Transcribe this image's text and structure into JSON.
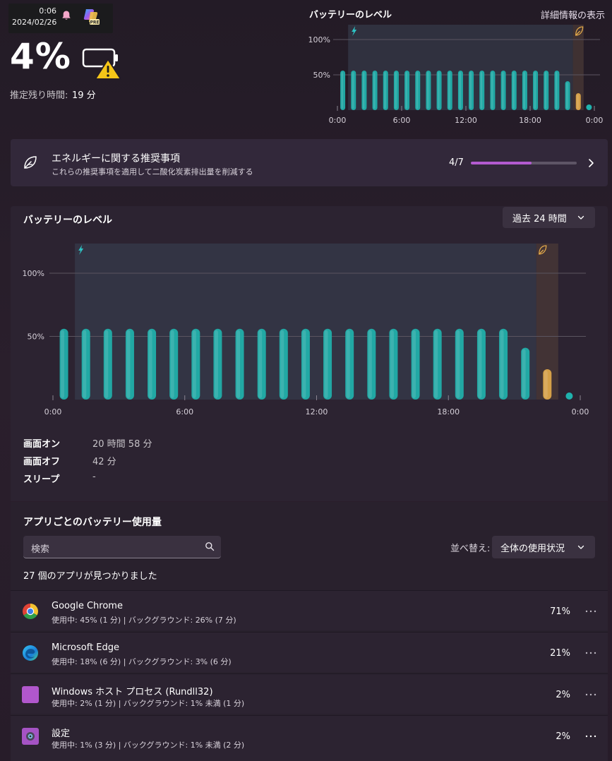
{
  "overlay": {
    "time": "0:06",
    "date": "2024/02/26",
    "bell_icon": "bell-icon",
    "copilot_icon": "copilot-pre-icon",
    "copilot_badge": "PRE"
  },
  "battery": {
    "percent": "4%",
    "icon": "battery-warning-icon",
    "remaining_label": "推定残り時間:",
    "remaining_value": "19 分"
  },
  "mini_chart": {
    "title": "バッテリーのレベル",
    "details_link": "詳細情報の表示"
  },
  "recommendation": {
    "icon": "leaf-icon",
    "title": "エネルギーに関する推奨事項",
    "subtitle": "これらの推奨事項を適用して二酸化炭素排出量を削減する",
    "count": "4/7",
    "progress": 0.571,
    "accent": "#b35bd0"
  },
  "battery_level": {
    "title": "バッテリーのレベル",
    "range_label": "過去 24 時間",
    "stats": [
      {
        "label": "画面オン",
        "value": "20 時間 58 分"
      },
      {
        "label": "画面オフ",
        "value": "42 分"
      },
      {
        "label": "スリープ",
        "value": "-"
      }
    ]
  },
  "chart_data": {
    "type": "bar",
    "xlabel": "",
    "ylabel": "",
    "y_ticks": [
      "100%",
      "50%"
    ],
    "x_ticks": [
      "0:00",
      "6:00",
      "12:00",
      "18:00",
      "0:00"
    ],
    "ylim": [
      0,
      100
    ],
    "xlim_hours": [
      0,
      24
    ],
    "bars": [
      {
        "hour": 0.5,
        "value": 56,
        "kind": "charging"
      },
      {
        "hour": 1.5,
        "value": 56,
        "kind": "charging"
      },
      {
        "hour": 2.5,
        "value": 56,
        "kind": "charging"
      },
      {
        "hour": 3.5,
        "value": 56,
        "kind": "charging"
      },
      {
        "hour": 4.5,
        "value": 56,
        "kind": "charging"
      },
      {
        "hour": 5.5,
        "value": 56,
        "kind": "charging"
      },
      {
        "hour": 6.5,
        "value": 56,
        "kind": "charging"
      },
      {
        "hour": 7.5,
        "value": 56,
        "kind": "charging"
      },
      {
        "hour": 8.5,
        "value": 56,
        "kind": "charging"
      },
      {
        "hour": 9.5,
        "value": 56,
        "kind": "charging"
      },
      {
        "hour": 10.5,
        "value": 56,
        "kind": "charging"
      },
      {
        "hour": 11.5,
        "value": 56,
        "kind": "charging"
      },
      {
        "hour": 12.5,
        "value": 56,
        "kind": "charging"
      },
      {
        "hour": 13.5,
        "value": 56,
        "kind": "charging"
      },
      {
        "hour": 14.5,
        "value": 56,
        "kind": "charging"
      },
      {
        "hour": 15.5,
        "value": 56,
        "kind": "charging"
      },
      {
        "hour": 16.5,
        "value": 56,
        "kind": "charging"
      },
      {
        "hour": 17.5,
        "value": 56,
        "kind": "charging"
      },
      {
        "hour": 18.5,
        "value": 56,
        "kind": "charging"
      },
      {
        "hour": 19.5,
        "value": 56,
        "kind": "charging"
      },
      {
        "hour": 20.5,
        "value": 56,
        "kind": "charging"
      },
      {
        "hour": 21.5,
        "value": 41,
        "kind": "discharging"
      },
      {
        "hour": 22.5,
        "value": 24,
        "kind": "saver"
      },
      {
        "hour": 23.5,
        "value": 4,
        "kind": "discharging"
      }
    ],
    "charging_period_hours": [
      1.0,
      22.0
    ],
    "saver_period_hours": [
      22.0,
      23.0
    ],
    "colors": {
      "bar": "#1fb2ad",
      "saver": "#e2a94a",
      "charge_icon": "#2ec3c4"
    }
  },
  "app_usage": {
    "title": "アプリごとのバッテリー使用量",
    "search_placeholder": "検索",
    "sort_label": "並べ替え:",
    "sort_value": "全体の使用状況",
    "found_text": "27 個のアプリが見つかりました",
    "apps": [
      {
        "name": "Google Chrome",
        "detail": "使用中: 45% (1 分) | バックグラウンド: 26% (7 分)",
        "percent": "71%",
        "icon": "chrome-icon"
      },
      {
        "name": "Microsoft Edge",
        "detail": "使用中: 18% (6 分) | バックグラウンド: 3% (6 分)",
        "percent": "21%",
        "icon": "edge-icon"
      },
      {
        "name": "Windows ホスト プロセス (Rundll32)",
        "detail": "使用中: 2% (1 分) | バックグラウンド: 1% 未満 (1 分)",
        "percent": "2%",
        "icon": "windows-host-process-icon"
      },
      {
        "name": "設定",
        "detail": "使用中: 1% (3 分) | バックグラウンド: 1% 未満 (2 分)",
        "percent": "2%",
        "icon": "settings-icon"
      }
    ]
  }
}
